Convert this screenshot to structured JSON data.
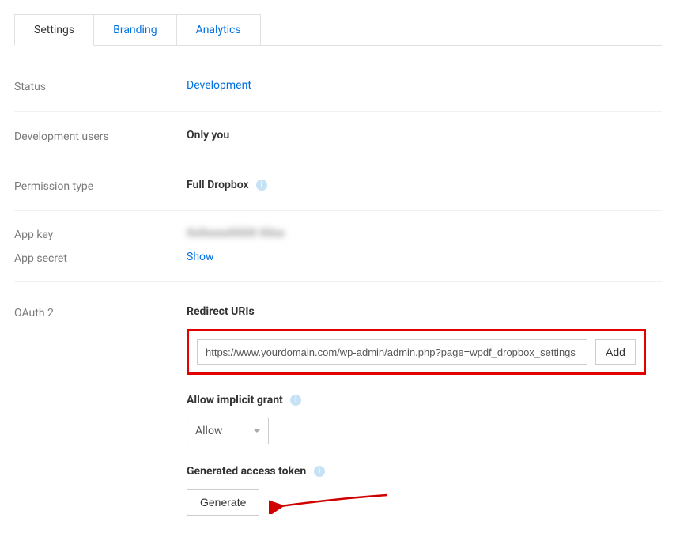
{
  "tabs": {
    "settings": "Settings",
    "branding": "Branding",
    "analytics": "Analytics"
  },
  "status": {
    "label": "Status",
    "value": "Development"
  },
  "dev_users": {
    "label": "Development users",
    "value": "Only you"
  },
  "permission": {
    "label": "Permission type",
    "value": "Full Dropbox"
  },
  "app_key": {
    "label": "App key",
    "value": "XxXxxxxXXXX XXxx"
  },
  "app_secret": {
    "label": "App secret",
    "value": "Show"
  },
  "oauth": {
    "label": "OAuth 2",
    "redirect_title": "Redirect URIs",
    "redirect_value": "https://www.yourdomain.com/wp-admin/admin.php?page=wpdf_dropbox_settings",
    "add_button": "Add",
    "implicit_title": "Allow implicit grant",
    "implicit_value": "Allow",
    "token_title": "Generated access token",
    "generate_button": "Generate"
  }
}
